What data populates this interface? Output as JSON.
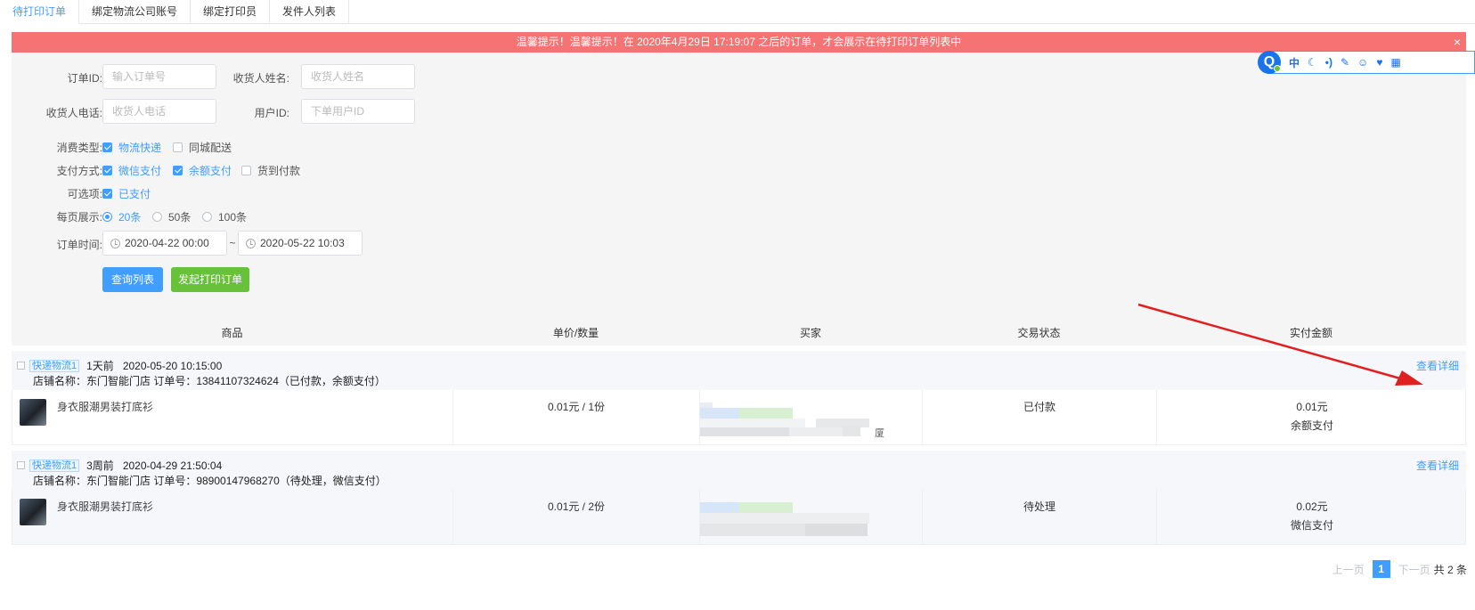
{
  "tabs": [
    {
      "label": "待打印订单",
      "active": true
    },
    {
      "label": "绑定物流公司账号",
      "active": false
    },
    {
      "label": "绑定打印员",
      "active": false
    },
    {
      "label": "发件人列表",
      "active": false
    }
  ],
  "notice": {
    "text": "温馨提示！温馨提示！在 2020年4月29日 17:19:07 之后的订单，才会展示在待打印订单列表中",
    "close": "×"
  },
  "toolbar": {
    "logo": "Q",
    "icons": [
      "中",
      "☾",
      "•)",
      "✎",
      "☺",
      "♥",
      "▦"
    ]
  },
  "filters": {
    "order_id": {
      "label": "订单ID:",
      "placeholder": "输入订单号"
    },
    "receiver_name": {
      "label": "收货人姓名:",
      "placeholder": "收货人姓名"
    },
    "receiver_phone": {
      "label": "收货人电话:",
      "placeholder": "收货人电话"
    },
    "user_id": {
      "label": "用户ID:",
      "placeholder": "下单用户ID"
    },
    "consume_type": {
      "label": "消费类型:",
      "options": [
        {
          "label": "物流快递",
          "checked": true
        },
        {
          "label": "同城配送",
          "checked": false
        }
      ]
    },
    "pay_method": {
      "label": "支付方式:",
      "options": [
        {
          "label": "微信支付",
          "checked": true
        },
        {
          "label": "余额支付",
          "checked": true
        },
        {
          "label": "货到付款",
          "checked": false
        }
      ]
    },
    "optional": {
      "label": "可选项:",
      "options": [
        {
          "label": "已支付",
          "checked": true
        }
      ]
    },
    "per_page": {
      "label": "每页展示:",
      "options": [
        {
          "label": "20条",
          "checked": true
        },
        {
          "label": "50条",
          "checked": false
        },
        {
          "label": "100条",
          "checked": false
        }
      ]
    },
    "order_time": {
      "label": "订单时间:",
      "start": "2020-04-22 00:00",
      "separator": "~",
      "end": "2020-05-22 10:03"
    },
    "query_button": "查询列表",
    "print_button": "发起打印订单"
  },
  "table": {
    "headers": [
      "商品",
      "单价/数量",
      "买家",
      "交易状态",
      "实付金额"
    ],
    "detail_link": "查看详细",
    "orders": [
      {
        "tag": "快递物流1",
        "ago": "1天前",
        "time": "2020-05-20 10:15:00",
        "store_line": "店铺名称：东门智能门店   订单号：13841107324624（已付款，余额支付）",
        "product": "身衣服潮男装打底衫",
        "price_qty": "0.01元 / 1份",
        "buyer_tail": "厦",
        "status": "已付款",
        "amount": "0.01元",
        "pay": "余额支付"
      },
      {
        "tag": "快递物流1",
        "ago": "3周前",
        "time": "2020-04-29 21:50:04",
        "store_line": "店铺名称：东门智能门店   订单号：98900147968270（待处理，微信支付）",
        "product": "身衣服潮男装打底衫",
        "price_qty": "0.01元 / 2份",
        "buyer_tail": "",
        "status": "待处理",
        "amount": "0.02元",
        "pay": "微信支付"
      }
    ]
  },
  "pager": {
    "prev": "上一页",
    "current": "1",
    "next": "下一页",
    "total": "共 2 条"
  },
  "colors": {
    "primary": "#409eff",
    "danger": "#f56c6c",
    "success": "#67c23a",
    "arrow": "#e02020"
  }
}
